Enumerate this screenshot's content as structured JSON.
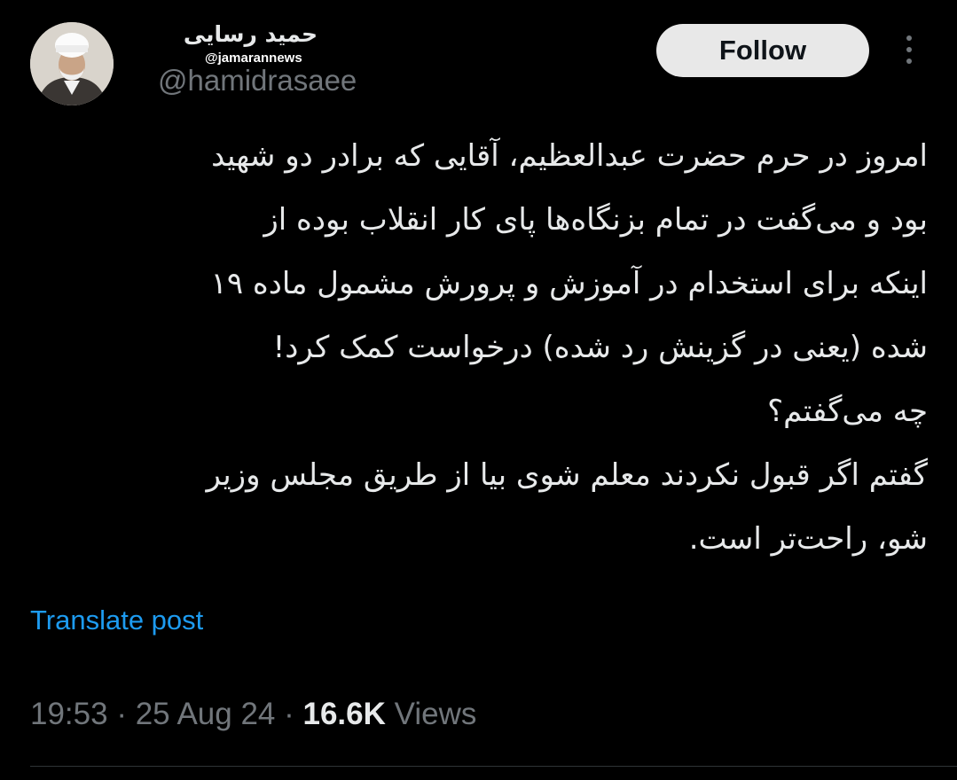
{
  "author": {
    "display_name": "حمید رسایی",
    "handle": "@hamidrasaee",
    "avatar_icon": "user-avatar-photo"
  },
  "watermark": "@jamarannews",
  "follow_label": "Follow",
  "more_icon": "more-vertical-icon",
  "post": {
    "lines": [
      "امروز در حرم حضرت عبدالعظیم، آقایی که برادر دو شهید",
      "بود و می‌گفت در تمام بزنگاه‌ها پای کار انقلاب بوده از",
      "اینکه برای استخدام در آموزش و پرورش مشمول ماده ۱۹",
      "شده (یعنی در گزینش رد شده) درخواست کمک کرد!",
      "چه می‌گفتم؟",
      "گفتم اگر قبول نکردند معلم شوی بیا از طریق مجلس وزیر",
      "شو، راحت‌تر است."
    ]
  },
  "translate_label": "Translate post",
  "meta": {
    "time": "19:53",
    "date": "25 Aug 24",
    "separator": "·",
    "views_count": "16.6K",
    "views_label": "Views"
  },
  "colors": {
    "background": "#000000",
    "text": "#e7e9ea",
    "secondary": "#71767b",
    "link": "#1d9bf0",
    "follow_bg": "#e8e8e8"
  }
}
